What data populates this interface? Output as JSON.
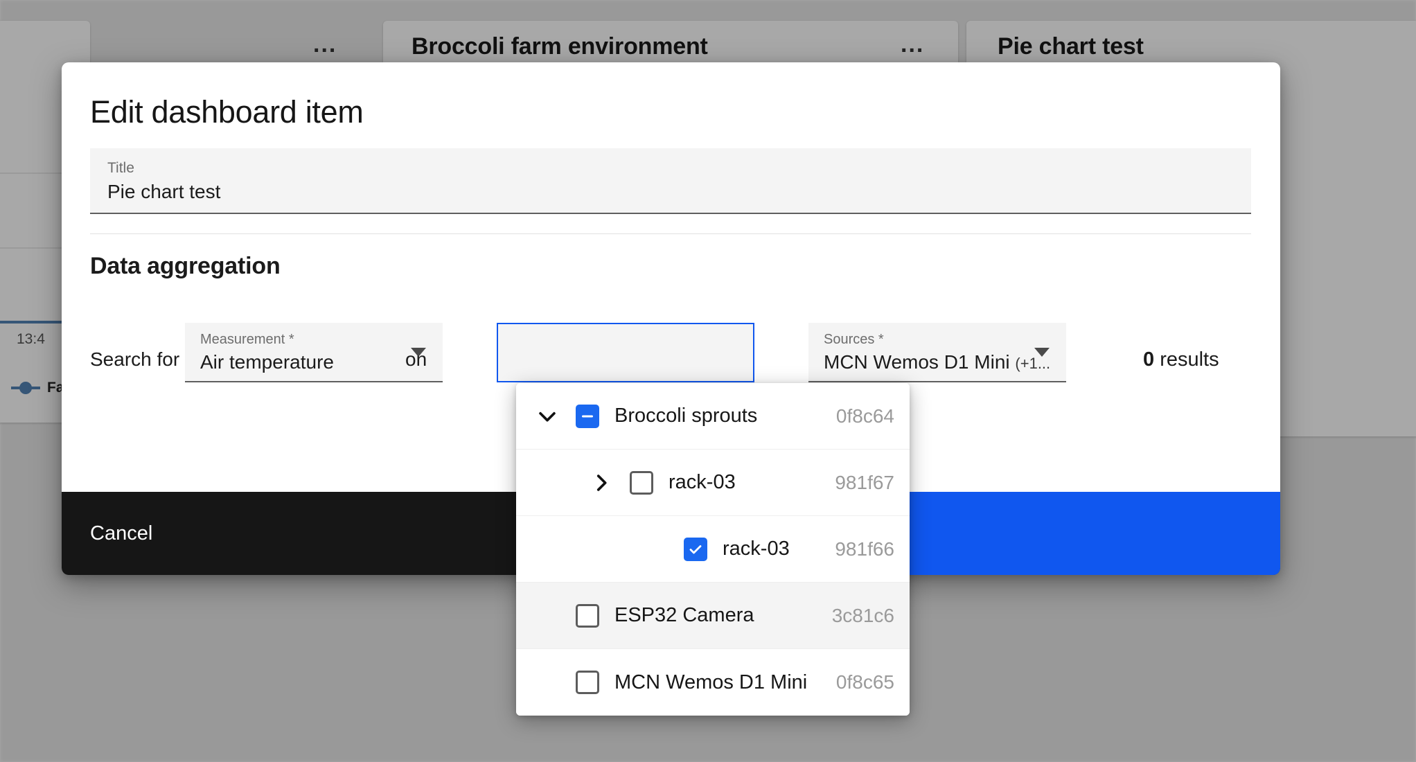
{
  "background": {
    "cards": [
      {
        "title": "",
        "dots": "..."
      },
      {
        "title": "Broccoli farm environment",
        "dots": "..."
      },
      {
        "title": "Pie chart test",
        "dots": ""
      }
    ],
    "chart": {
      "x_tick": "13:4",
      "legend_label": "Fa",
      "line_color": "#5383b5"
    }
  },
  "dialog": {
    "heading": "Edit dashboard item",
    "title_field": {
      "label": "Title",
      "value": "Pie chart test"
    },
    "section_heading": "Data aggregation",
    "aggregation": {
      "prefix_label": "Search for",
      "middle_label": "on",
      "measurement": {
        "label": "Measurement *",
        "value": "Air temperature"
      },
      "variable": {
        "label": "",
        "value": ""
      },
      "sources": {
        "label": "Sources *",
        "value": "MCN Wemos D1 Mini",
        "suffix": "(+1..."
      },
      "results_count": "0",
      "results_word": "results"
    },
    "footer": {
      "cancel_label": "Cancel",
      "save_label": ""
    }
  },
  "tree_dropdown": {
    "rows": [
      {
        "label": "Broccoli sprouts",
        "id": "0f8c64",
        "checkbox": "indeterminate",
        "toggle": "chevron-down-icon",
        "indent": 0,
        "highlight": false,
        "ring": false
      },
      {
        "label": "rack-03",
        "id": "981f67",
        "checkbox": "unchecked",
        "toggle": "chevron-right-icon",
        "indent": 1,
        "highlight": false,
        "ring": false
      },
      {
        "label": "rack-03",
        "id": "981f66",
        "checkbox": "checked",
        "toggle": "none",
        "indent": 2,
        "highlight": false,
        "ring": true
      },
      {
        "label": "ESP32 Camera",
        "id": "3c81c6",
        "checkbox": "unchecked",
        "toggle": "none",
        "indent": 0,
        "highlight": true,
        "ring": false
      },
      {
        "label": "MCN Wemos D1 Mini",
        "id": "0f8c65",
        "checkbox": "unchecked",
        "toggle": "none",
        "indent": 0,
        "highlight": false,
        "ring": false
      }
    ]
  },
  "colors": {
    "accent_blue": "#1057ef",
    "checkbox_blue": "#1a68f0",
    "footer_dark": "#161616",
    "field_bg": "#f4f4f4"
  }
}
